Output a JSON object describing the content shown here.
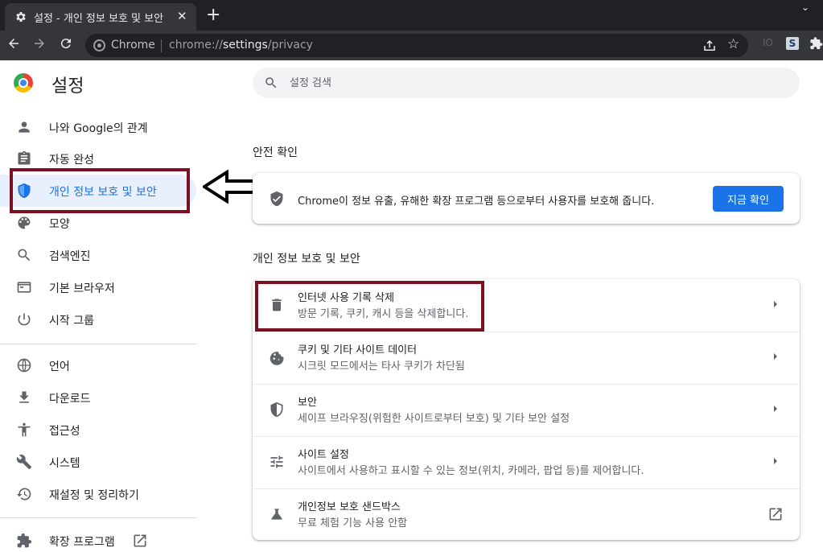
{
  "tab": {
    "title": "설정 - 개인 정보 보호 및 보안",
    "close": "✕",
    "new_tab": "+"
  },
  "omnibox": {
    "scheme_label": "Chrome",
    "url_prefix": "chrome://",
    "url_host": "settings",
    "url_path": "/privacy"
  },
  "toolbar": {
    "ext_faded": "IO",
    "ext_s": "S"
  },
  "app": {
    "title": "설정"
  },
  "sidebar": {
    "items": [
      {
        "label": "나와 Google의 관계",
        "icon": "person-icon"
      },
      {
        "label": "자동 완성",
        "icon": "clipboard-icon"
      },
      {
        "label": "개인 정보 보호 및 보안",
        "icon": "shield-icon",
        "active": true
      },
      {
        "label": "모양",
        "icon": "palette-icon"
      },
      {
        "label": "검색엔진",
        "icon": "search-icon"
      },
      {
        "label": "기본 브라우저",
        "icon": "browser-icon"
      },
      {
        "label": "시작 그룹",
        "icon": "power-icon"
      }
    ],
    "advanced_items": [
      {
        "label": "언어",
        "icon": "globe-icon"
      },
      {
        "label": "다운로드",
        "icon": "download-icon"
      },
      {
        "label": "접근성",
        "icon": "accessibility-icon"
      },
      {
        "label": "시스템",
        "icon": "wrench-icon"
      },
      {
        "label": "재설정 및 정리하기",
        "icon": "history-icon"
      }
    ],
    "extensions": {
      "label": "확장 프로그램",
      "icon": "puzzle-icon"
    }
  },
  "search": {
    "placeholder": "설정 검색"
  },
  "safety": {
    "heading": "안전 확인",
    "text": "Chrome이 정보 유출, 유해한 확장 프로그램 등으로부터 사용자를 보호해 줍니다.",
    "button": "지금 확인"
  },
  "privacy": {
    "heading": "개인 정보 보호 및 보안",
    "rows": [
      {
        "title": "인터넷 사용 기록 삭제",
        "subtitle": "방문 기록, 쿠키, 캐시 등을 삭제합니다.",
        "icon": "trash-icon"
      },
      {
        "title": "쿠키 및 기타 사이트 데이터",
        "subtitle": "시크릿 모드에서는 타사 쿠키가 차단됨",
        "icon": "cookie-icon"
      },
      {
        "title": "보안",
        "subtitle": "세이프 브라우징(위험한 사이트로부터 보호) 및 기타 보안 설정",
        "icon": "shield-icon"
      },
      {
        "title": "사이트 설정",
        "subtitle": "사이트에서 사용하고 표시할 수 있는 정보(위치, 카메라, 팝업 등)를 제어합니다.",
        "icon": "tune-icon"
      },
      {
        "title": "개인정보 보호 샌드박스",
        "subtitle": "무료 체험 기능 사용 안함",
        "icon": "flask-icon"
      }
    ]
  },
  "colors": {
    "accent": "#1a73e8",
    "highlight_border": "#7b1020",
    "active_bg": "#e8f0fe"
  }
}
